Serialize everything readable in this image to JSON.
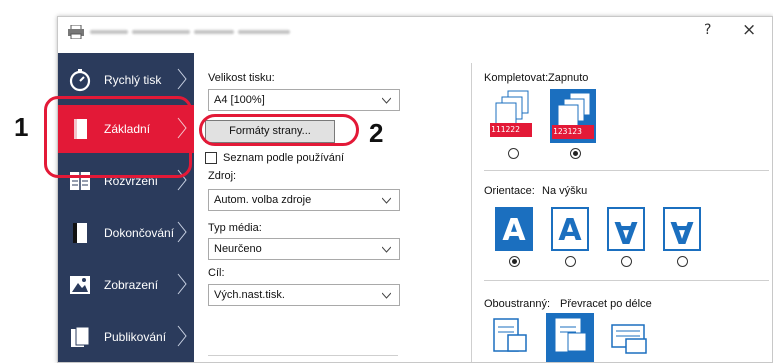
{
  "title_bar": {
    "help_label": "?",
    "close_label": "×"
  },
  "sidebar": {
    "items": [
      {
        "label": "Rychlý tisk"
      },
      {
        "label": "Základní"
      },
      {
        "label": "Rozvržení"
      },
      {
        "label": "Dokončování"
      },
      {
        "label": "Zobrazení"
      },
      {
        "label": "Publikování"
      }
    ]
  },
  "print_size": {
    "label": "Velikost tisku:",
    "value": "A4  [100%]"
  },
  "page_formats_button": {
    "label": "Formáty strany..."
  },
  "list_by_use": {
    "label": "Seznam podle používání"
  },
  "source": {
    "label": "Zdroj:",
    "value": "Autom. volba zdroje"
  },
  "media_type": {
    "label": "Typ média:",
    "value": "Neurčeno"
  },
  "destination": {
    "label": "Cíl:",
    "value": "Vých.nast.tisk."
  },
  "collate": {
    "label": "Kompletovat:",
    "state": "Zapnuto",
    "left_digits": "111222",
    "right_digits": "123123"
  },
  "orientation": {
    "label": "Orientace:",
    "state": "Na výšku",
    "glyph": "A"
  },
  "duplex": {
    "label": "Oboustranný:",
    "state": "Převracet po délce"
  },
  "callouts": {
    "one": "1",
    "two": "2"
  },
  "colors": {
    "sidebar_bg": "#2b3b5c",
    "active_red": "#e31937",
    "accent_blue": "#1b6fbf"
  }
}
